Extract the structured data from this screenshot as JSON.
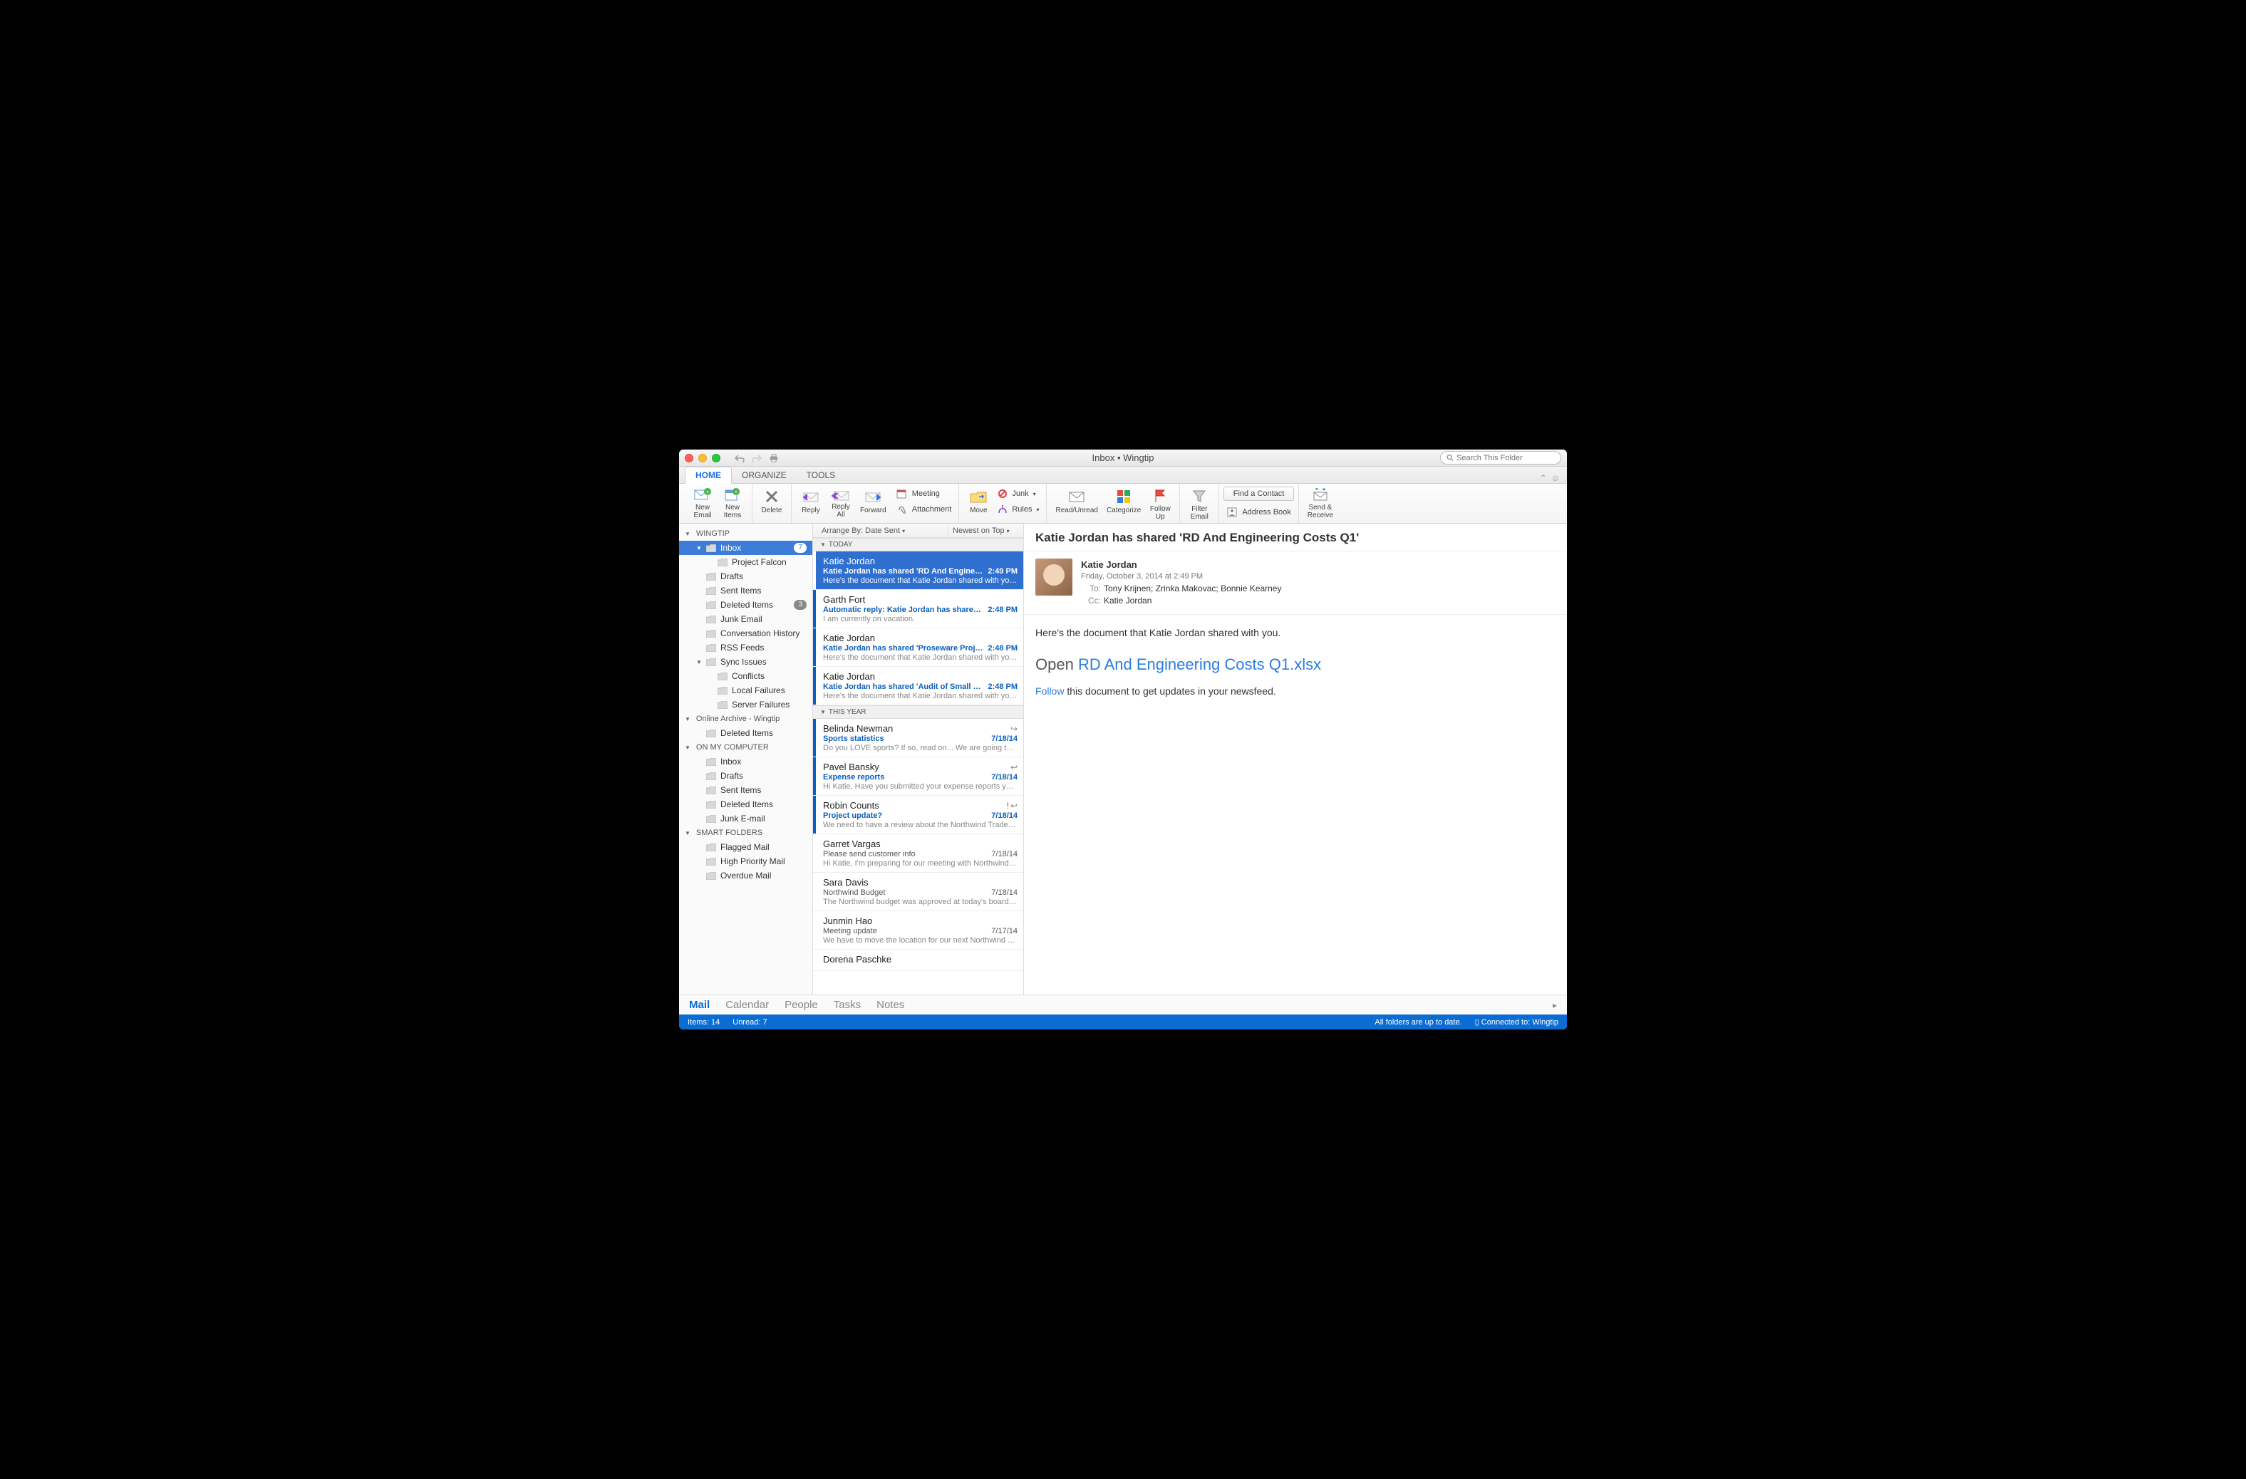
{
  "window": {
    "title": "Inbox • Wingtip"
  },
  "search": {
    "placeholder": "Search This Folder"
  },
  "ribbonTabs": {
    "home": "HOME",
    "organize": "ORGANIZE",
    "tools": "TOOLS"
  },
  "ribbon": {
    "newEmail": "New\nEmail",
    "newItems": "New\nItems",
    "delete": "Delete",
    "reply": "Reply",
    "replyAll": "Reply\nAll",
    "forward": "Forward",
    "meeting": "Meeting",
    "attachment": "Attachment",
    "move": "Move",
    "junk": "Junk",
    "rules": "Rules",
    "readUnread": "Read/Unread",
    "categorize": "Categorize",
    "followUp": "Follow\nUp",
    "filterEmail": "Filter\nEmail",
    "findContact": "Find a Contact",
    "addressBook": "Address Book",
    "sendReceive": "Send &\nReceive"
  },
  "sidebar": {
    "accounts": [
      {
        "name": "WINGTIP",
        "folders": [
          {
            "label": "Inbox",
            "selected": true,
            "badge": "7",
            "children": [
              {
                "label": "Project Falcon"
              }
            ]
          },
          {
            "label": "Drafts"
          },
          {
            "label": "Sent Items"
          },
          {
            "label": "Deleted Items",
            "badge": "3"
          },
          {
            "label": "Junk Email"
          },
          {
            "label": "Conversation History"
          },
          {
            "label": "RSS Feeds"
          },
          {
            "label": "Sync Issues",
            "children": [
              {
                "label": "Conflicts"
              },
              {
                "label": "Local Failures"
              },
              {
                "label": "Server Failures"
              }
            ]
          }
        ]
      },
      {
        "name": "Online Archive - Wingtip",
        "folders": [
          {
            "label": "Deleted Items"
          }
        ]
      },
      {
        "name": "ON MY COMPUTER",
        "folders": [
          {
            "label": "Inbox"
          },
          {
            "label": "Drafts"
          },
          {
            "label": "Sent Items"
          },
          {
            "label": "Deleted Items"
          },
          {
            "label": "Junk E-mail"
          }
        ]
      },
      {
        "name": "SMART FOLDERS",
        "folders": [
          {
            "label": "Flagged Mail"
          },
          {
            "label": "High Priority Mail"
          },
          {
            "label": "Overdue Mail"
          }
        ]
      }
    ]
  },
  "listHeader": {
    "arrange": "Arrange By: Date Sent",
    "sort": "Newest on Top"
  },
  "groups": [
    {
      "label": "TODAY",
      "messages": [
        {
          "sender": "Katie Jordan",
          "subject": "Katie Jordan has shared 'RD And Engineeri…",
          "time": "2:49 PM",
          "preview": "Here's the document that Katie Jordan shared with you…",
          "unread": true,
          "selected": true
        },
        {
          "sender": "Garth Fort",
          "subject": "Automatic reply: Katie Jordan has shared '…",
          "time": "2:48 PM",
          "preview": "I am currently on vacation.",
          "unread": true
        },
        {
          "sender": "Katie Jordan",
          "subject": "Katie Jordan has shared 'Proseware Projec…",
          "time": "2:48 PM",
          "preview": "Here's the document that Katie Jordan shared with you…",
          "unread": true
        },
        {
          "sender": "Katie Jordan",
          "subject": "Katie Jordan has shared 'Audit of Small Bu…",
          "time": "2:48 PM",
          "preview": "Here's the document that Katie Jordan shared with you…",
          "unread": true
        }
      ]
    },
    {
      "label": "THIS YEAR",
      "messages": [
        {
          "sender": "Belinda Newman",
          "subject": "Sports statistics",
          "time": "7/18/14",
          "preview": "Do you LOVE sports? If so, read on... We are going to…",
          "unread": true,
          "marks": [
            "forwarded"
          ]
        },
        {
          "sender": "Pavel Bansky",
          "subject": "Expense reports",
          "time": "7/18/14",
          "preview": "Hi Katie, Have you submitted your expense reports yet…",
          "unread": true,
          "marks": [
            "replied"
          ]
        },
        {
          "sender": "Robin Counts",
          "subject": "Project update?",
          "time": "7/18/14",
          "preview": "We need to have a review about the Northwind Traders…",
          "unread": true,
          "marks": [
            "important",
            "replied"
          ]
        },
        {
          "sender": "Garret Vargas",
          "subject": "Please send customer info",
          "time": "7/18/14",
          "preview": "Hi Katie, I'm preparing for our meeting with Northwind,…",
          "read": true
        },
        {
          "sender": "Sara Davis",
          "subject": "Northwind Budget",
          "time": "7/18/14",
          "preview": "The Northwind budget was approved at today's board…",
          "read": true
        },
        {
          "sender": "Junmin Hao",
          "subject": "Meeting update",
          "time": "7/17/14",
          "preview": "We have to move the location for our next Northwind Tr…",
          "read": true
        },
        {
          "sender": "Dorena Paschke",
          "subject": "",
          "time": "",
          "preview": "",
          "read": true
        }
      ]
    }
  ],
  "reading": {
    "subject": "Katie Jordan has shared 'RD And Engineering Costs Q1'",
    "from": "Katie Jordan",
    "date": "Friday, October 3, 2014 at 2:49 PM",
    "toLabel": "To:",
    "ccLabel": "Cc:",
    "to": "Tony Krijnen;   Zrinka Makovac;   Bonnie Kearney",
    "cc": "Katie Jordan",
    "body_line1": "Here's the document that Katie Jordan shared with you.",
    "open_prefix": "Open ",
    "open_link": "RD And Engineering Costs Q1.xlsx",
    "follow_link": "Follow",
    "follow_suffix": " this document to get updates in your newsfeed."
  },
  "modules": {
    "mail": "Mail",
    "calendar": "Calendar",
    "people": "People",
    "tasks": "Tasks",
    "notes": "Notes"
  },
  "status": {
    "items": "Items: 14",
    "unread": "Unread: 7",
    "sync": "All folders are up to date.",
    "connected": "Connected to: Wingtip"
  }
}
